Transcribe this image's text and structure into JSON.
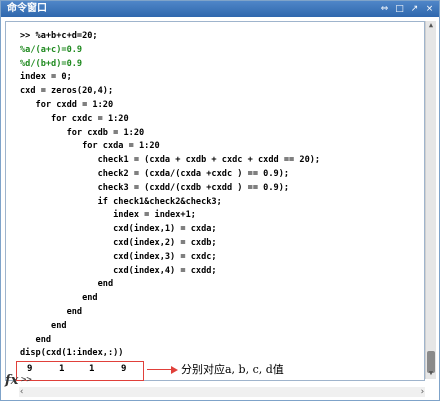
{
  "window": {
    "title": "命令窗口",
    "buttons": [
      "⇔",
      "□",
      "↗",
      "×"
    ]
  },
  "code_lines": [
    {
      "text": ">> %a+b+c+d=20;",
      "green": false
    },
    {
      "text": "%a/(a+c)=0.9",
      "green": true
    },
    {
      "text": "%d/(b+d)=0.9",
      "green": true
    },
    {
      "text": "index = 0;",
      "green": false
    },
    {
      "text": "cxd = zeros(20,4);",
      "green": false
    },
    {
      "text": "   for cxdd = 1:20",
      "green": false
    },
    {
      "text": "      for cxdc = 1:20",
      "green": false
    },
    {
      "text": "         for cxdb = 1:20",
      "green": false
    },
    {
      "text": "            for cxda = 1:20",
      "green": false
    },
    {
      "text": "               check1 = (cxda + cxdb + cxdc + cxdd == 20);",
      "green": false
    },
    {
      "text": "               check2 = (cxda/(cxda +cxdc ) == 0.9);",
      "green": false
    },
    {
      "text": "               check3 = (cxdd/(cxdb +cxdd ) == 0.9);",
      "green": false
    },
    {
      "text": "               if check1&check2&check3;",
      "green": false
    },
    {
      "text": "                  index = index+1;",
      "green": false
    },
    {
      "text": "                  cxd(index,1) = cxda;",
      "green": false
    },
    {
      "text": "                  cxd(index,2) = cxdb;",
      "green": false
    },
    {
      "text": "                  cxd(index,3) = cxdc;",
      "green": false
    },
    {
      "text": "                  cxd(index,4) = cxdd;",
      "green": false
    },
    {
      "text": "               end",
      "green": false
    },
    {
      "text": "            end",
      "green": false
    },
    {
      "text": "         end",
      "green": false
    },
    {
      "text": "      end",
      "green": false
    },
    {
      "text": "   end",
      "green": false
    },
    {
      "text": "disp(cxd(1:index,:))",
      "green": false
    }
  ],
  "result": {
    "values": [
      "9",
      "1",
      "1",
      "9"
    ]
  },
  "annotation": "分别对应a, b, c, d值",
  "prompt": {
    "fx": "fx",
    "symbol": ">>"
  },
  "colors": {
    "comment": "#1f8a1f",
    "highlight": "#e0403a",
    "titlebar": "#2f67ad"
  }
}
